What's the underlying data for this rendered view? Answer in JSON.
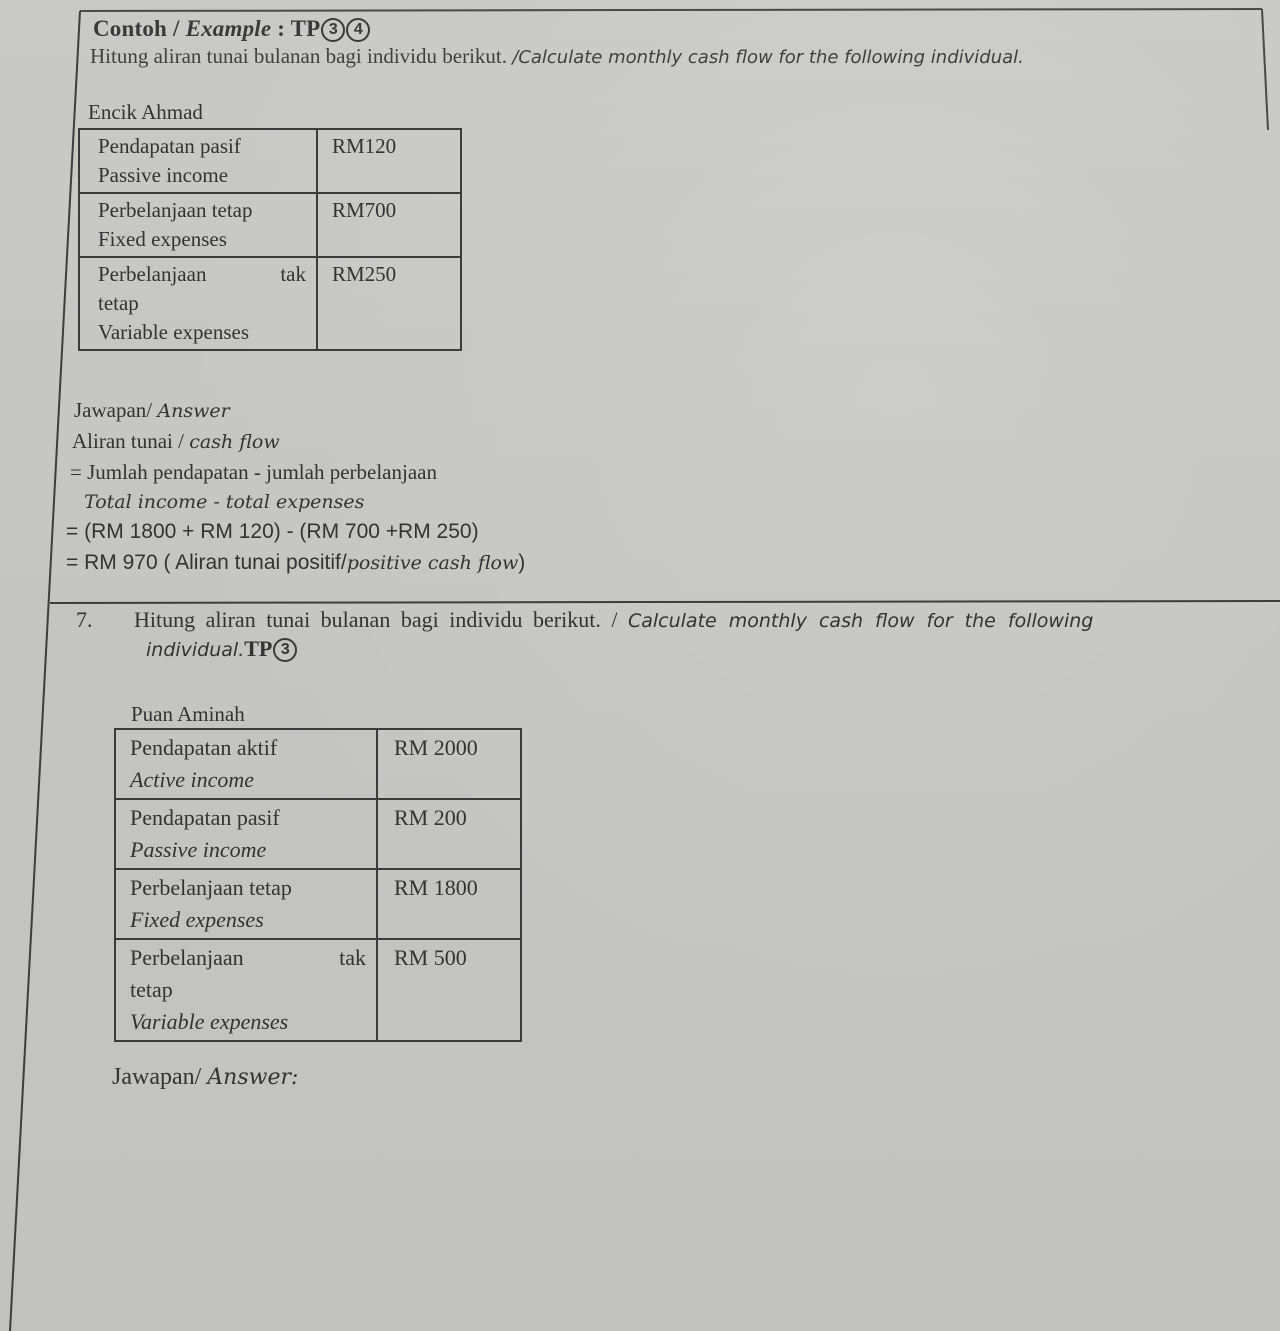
{
  "example": {
    "heading_ms": "Contoh",
    "heading_sep": " / ",
    "heading_en": "Example",
    "heading_colon": " :  TP",
    "tp_levels": [
      "3",
      "4"
    ],
    "instruction_ms": "Hitung aliran tunai bulanan bagi individu berikut. ",
    "instruction_en": "/Calculate monthly cash flow for  the following individual.",
    "person": "Encik Ahmad",
    "rows": [
      {
        "label_ms": "Pendapatan pasif",
        "label_ms_split": null,
        "label_en": "Passive income",
        "value": "RM120"
      },
      {
        "label_ms": "Perbelanjaan tetap",
        "label_ms_split": null,
        "label_en": "Fixed expenses",
        "value": "RM700"
      },
      {
        "label_ms": "Perbelanjaan",
        "label_ms_split": [
          "tak",
          "tetap"
        ],
        "label_en": "Variable expenses",
        "value": "RM250"
      }
    ],
    "answer": {
      "heading_ms": "Jawapan/ ",
      "heading_en": "Answer",
      "cashflow_ms": "Aliran tunai / ",
      "cashflow_en": "cash flow",
      "formula_ms": "= Jumlah pendapatan - jumlah perbelanjaan",
      "formula_en": "Total income - total expenses",
      "substitution": "= (RM 1800 + RM 120) - (RM 700 +RM 250)",
      "result_prefix": "= RM 970 ( Aliran tunai positif/",
      "result_en": "positive cash flow",
      "result_suffix": ")"
    }
  },
  "question7": {
    "number": "7.",
    "instruction_ms": "Hitung aliran tunai bulanan bagi individu berikut. / ",
    "instruction_en": "Calculate monthly cash flow for  the following",
    "instruction_en_cont": "individual.",
    "tp_label": "TP",
    "tp_levels": [
      "3"
    ],
    "person": "Puan Aminah",
    "rows": [
      {
        "label_ms": "Pendapatan aktif",
        "label_en": "Active income",
        "value": "RM 2000"
      },
      {
        "label_ms": "Pendapatan pasif",
        "label_en": "Passive income",
        "value": "RM 200"
      },
      {
        "label_ms": "Perbelanjaan tetap",
        "label_en": "Fixed expenses",
        "value": "RM 1800"
      },
      {
        "label_ms": "Perbelanjaan",
        "label_ms_split": [
          "tak",
          "tetap"
        ],
        "label_en": "Variable expenses",
        "value": "RM 500"
      }
    ],
    "answer_heading_ms": "Jawapan/ ",
    "answer_heading_en": "Answer:",
    "answer_value": ""
  }
}
